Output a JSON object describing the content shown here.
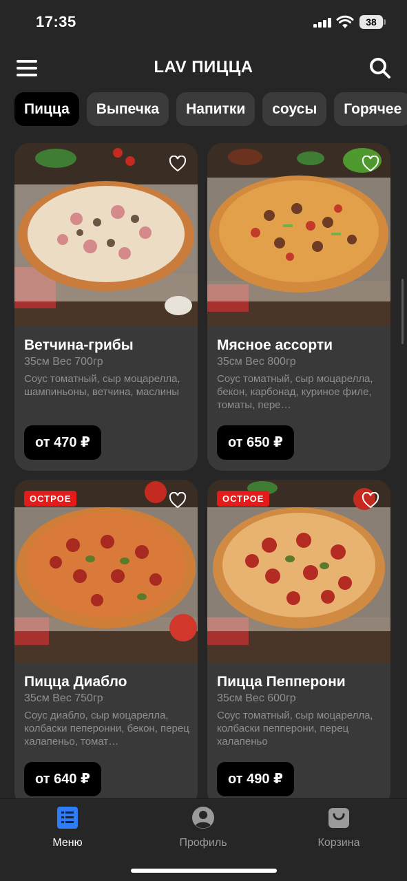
{
  "status_bar": {
    "time": "17:35",
    "battery": "38"
  },
  "header": {
    "title": "LAV ПИЦЦА"
  },
  "tabs": [
    {
      "label": "Пицца",
      "active": true
    },
    {
      "label": "Выпечка",
      "active": false
    },
    {
      "label": "Напитки",
      "active": false
    },
    {
      "label": "соусы",
      "active": false
    },
    {
      "label": "Горячее",
      "active": false
    }
  ],
  "products": [
    {
      "title": "Ветчина-грибы",
      "weight": "35см Вес 700гр",
      "description": "Соус томатный, сыр моцарелла, шампиньоны, ветчина, маслины",
      "price": "от 470 ₽",
      "badge": ""
    },
    {
      "title": "Мясное ассорти",
      "weight": "35см Вес 800гр",
      "description": "Соус томатный, сыр моцарелла, бекон, карбонад, куриное филе, томаты, пере…",
      "price": "от 650 ₽",
      "badge": ""
    },
    {
      "title": "Пицца Диабло",
      "weight": "35см Вес 750гр",
      "description": "Соус диабло, сыр моцарелла, колбаски пеперонни, бекон, перец халапеньо, томат…",
      "price": "от 640 ₽",
      "badge": "ОСТРОЕ"
    },
    {
      "title": "Пицца Пепперони",
      "weight": "35см Вес 600гр",
      "description": "Соус томатный, сыр моцарелла, колбаски пепперони, перец халапеньо",
      "price": "от 490 ₽",
      "badge": "ОСТРОЕ"
    }
  ],
  "bottom_nav": [
    {
      "label": "Меню",
      "icon": "menu-list-icon",
      "active": true
    },
    {
      "label": "Профиль",
      "icon": "profile-icon",
      "active": false
    },
    {
      "label": "Корзина",
      "icon": "cart-bag-icon",
      "active": false
    }
  ],
  "colors": {
    "background": "#262626",
    "card": "#393939",
    "accent_blue": "#2f7df6",
    "badge_red": "#e41b1b",
    "muted_text": "#8e8e8e"
  }
}
